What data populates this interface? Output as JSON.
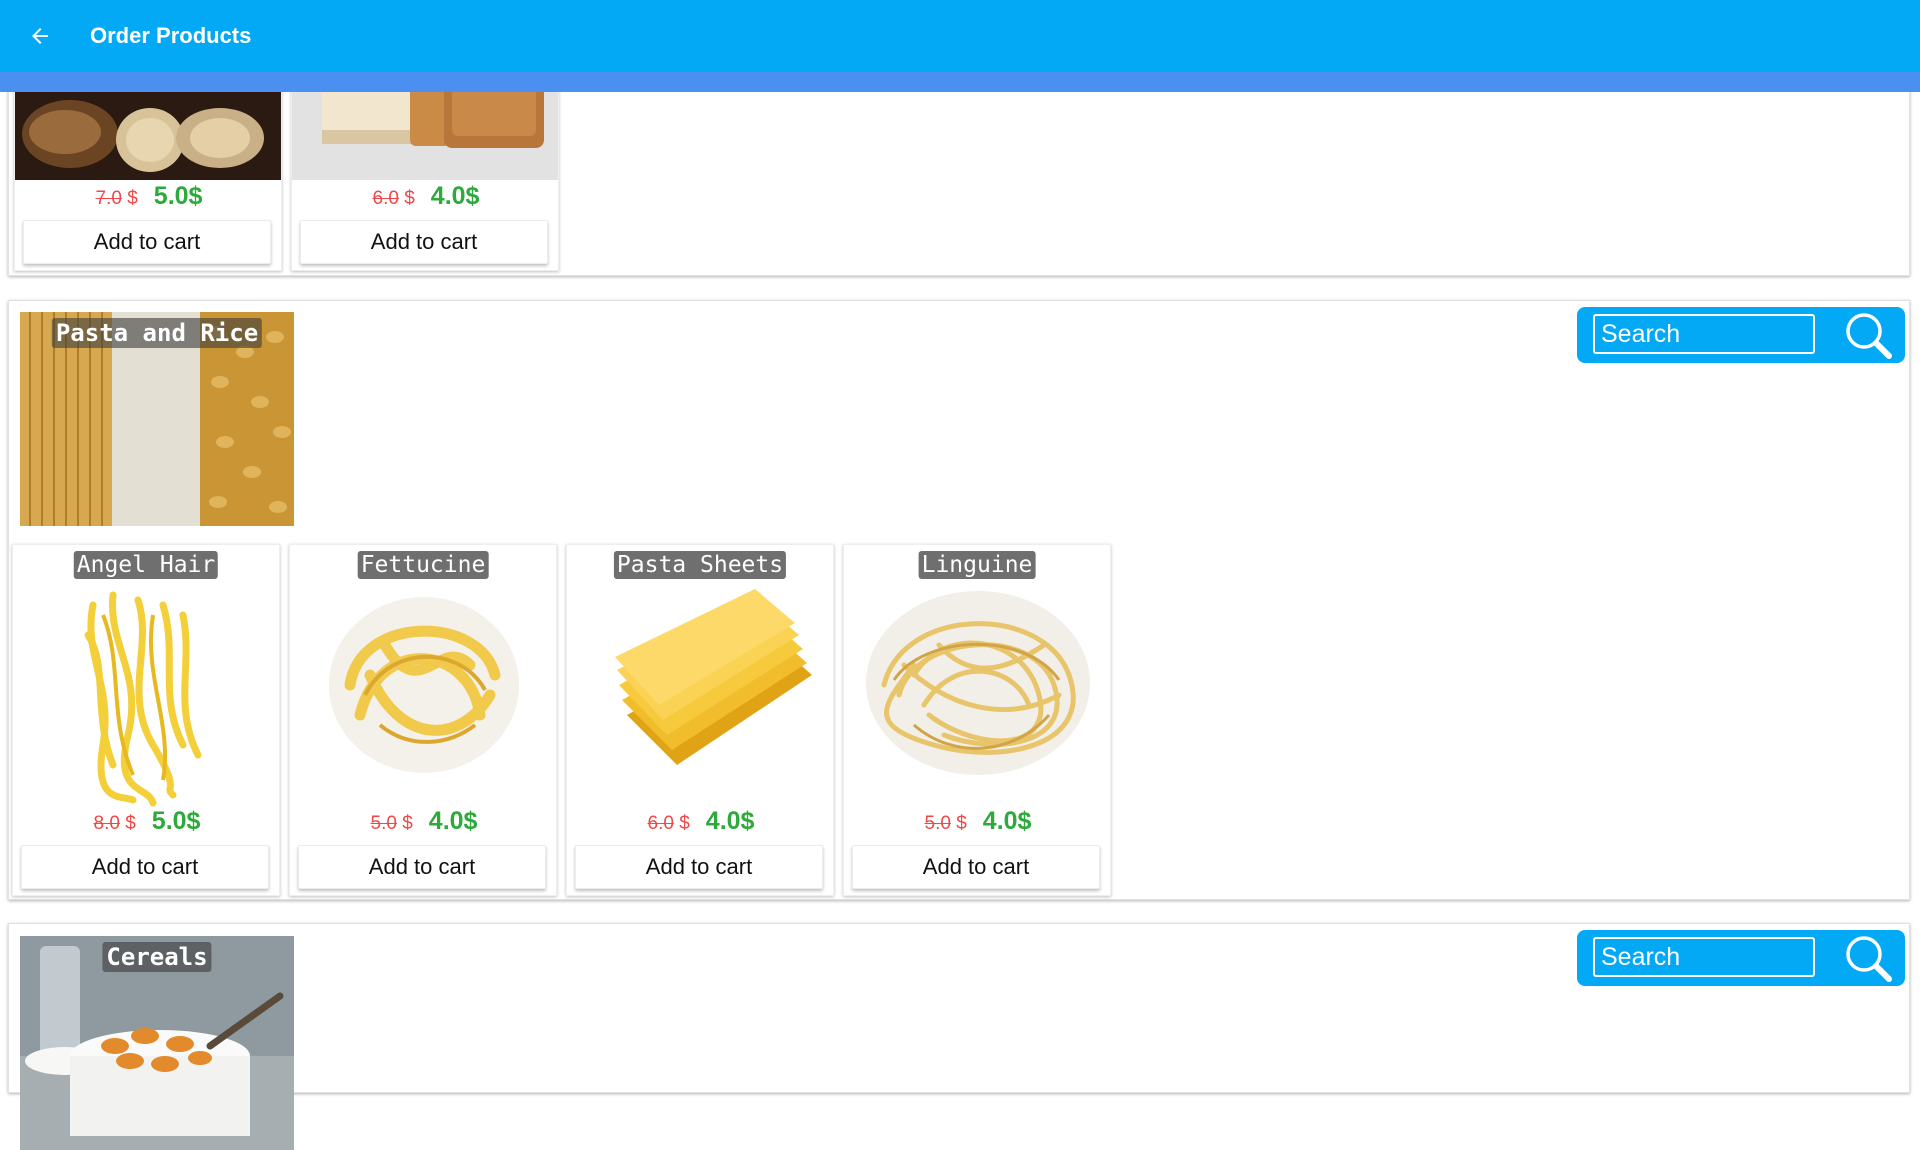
{
  "app_bar": {
    "title": "Order Products",
    "back_icon": "arrow-back-icon",
    "color": "#03A9F4"
  },
  "bread_section": {
    "products": [
      {
        "old_price": "7.0",
        "currency": "$",
        "price": "5.0$",
        "button": "Add to cart"
      },
      {
        "old_price": "6.0",
        "currency": "$",
        "price": "4.0$",
        "button": "Add to cart"
      }
    ]
  },
  "pasta_section": {
    "category": "Pasta and Rice",
    "search_placeholder": "Search",
    "products": [
      {
        "name": "Angel Hair",
        "old_price": "8.0",
        "currency": "$",
        "price": "5.0$",
        "button": "Add to cart"
      },
      {
        "name": "Fettucine",
        "old_price": "5.0",
        "currency": "$",
        "price": "4.0$",
        "button": "Add to cart"
      },
      {
        "name": "Pasta Sheets",
        "old_price": "6.0",
        "currency": "$",
        "price": "4.0$",
        "button": "Add to cart"
      },
      {
        "name": "Linguine",
        "old_price": "5.0",
        "currency": "$",
        "price": "4.0$",
        "button": "Add to cart"
      }
    ]
  },
  "cereals_section": {
    "category": "Cereals",
    "search_placeholder": "Search"
  },
  "colors": {
    "old_price": "#f04848",
    "new_price": "#2eaa3c",
    "search_bg": "#03A9F4"
  }
}
